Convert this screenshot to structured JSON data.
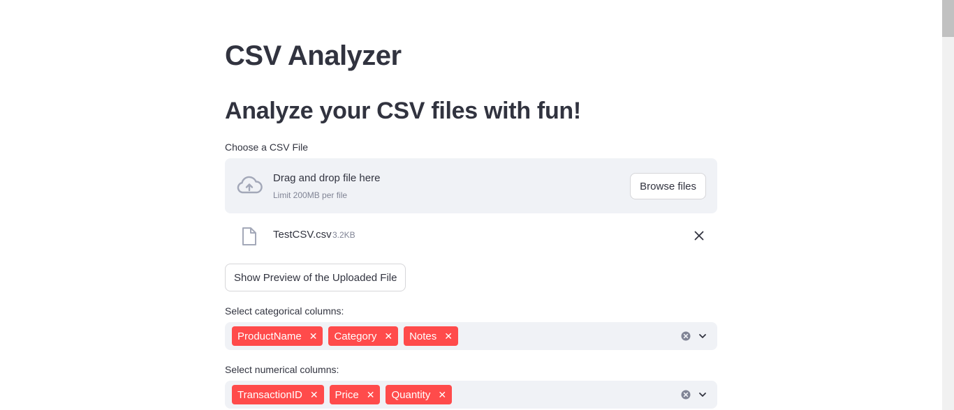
{
  "header": {
    "title": "CSV Analyzer",
    "subtitle": "Analyze your CSV files with fun!"
  },
  "uploader": {
    "label": "Choose a CSV File",
    "drop_title": "Drag and drop file here",
    "limit": "Limit 200MB per file",
    "browse_label": "Browse files",
    "icon": "cloud-upload-icon",
    "file": {
      "name": "TestCSV.csv",
      "size": "3.2KB",
      "icon": "file-icon"
    }
  },
  "preview_button": {
    "label": "Show Preview of the Uploaded File"
  },
  "categorical": {
    "label": "Select categorical columns:",
    "tags": [
      "ProductName",
      "Category",
      "Notes"
    ]
  },
  "numerical": {
    "label": "Select numerical columns:",
    "tags": [
      "TransactionID",
      "Price",
      "Quantity"
    ]
  },
  "colors": {
    "primary": "#ff4b4b",
    "text": "#31333f",
    "muted": "#808495",
    "input_bg": "#f0f2f6"
  }
}
